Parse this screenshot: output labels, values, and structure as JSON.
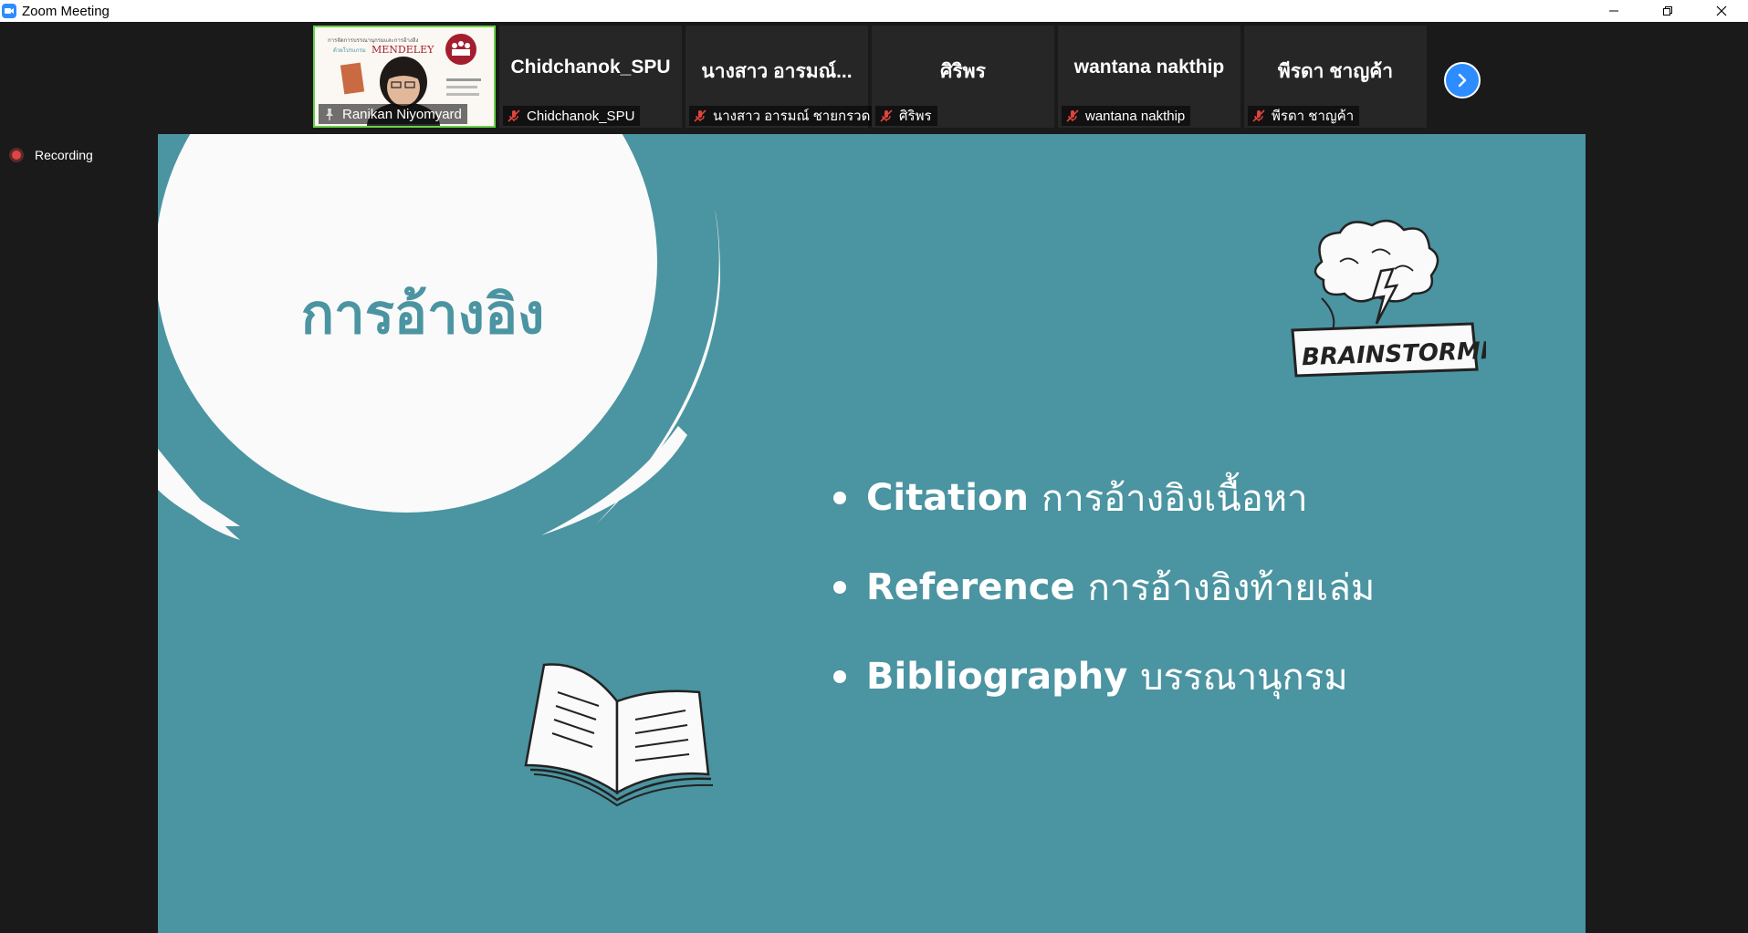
{
  "window": {
    "title": "Zoom Meeting",
    "icon": "zoom-camera-icon"
  },
  "thumbnail": {
    "heading": "การจัดการบรรณานุกรมและการอ้างอิง",
    "sub": "ด้วยโปรแกรม",
    "brand": "MENDELEY"
  },
  "participants": [
    {
      "name": "Ranikan Niyomyard",
      "type": "video",
      "pinned": true
    },
    {
      "display": "Chidchanok_SPU",
      "name": "Chidchanok_SPU",
      "muted": true
    },
    {
      "display": "นางสาว อารมณ์...",
      "name": "นางสาว อารมณ์ ชายกรวด",
      "muted": true
    },
    {
      "display": "ศิริพร",
      "name": "ศิริพร",
      "muted": true
    },
    {
      "display": "wantana nakthip",
      "name": "wantana nakthip",
      "muted": true
    },
    {
      "display": "พีรดา ชาญค้า",
      "name": "พีรดา ชาญค้า",
      "muted": true
    }
  ],
  "recording": {
    "label": "Recording"
  },
  "slide": {
    "title": "การอ้างอิง",
    "badge": "BRAINSTORMING",
    "bullets": [
      {
        "term": "Citation",
        "thai": "การอ้างอิงเนื้อหา"
      },
      {
        "term": "Reference",
        "thai": "การอ้างอิงท้ายเล่ม"
      },
      {
        "term": "Bibliography",
        "thai": "บรรณานุกรม"
      }
    ]
  },
  "colors": {
    "slide_bg": "#4b94a1",
    "accent": "#2d8cff",
    "mute_red": "#e0443e",
    "recording_red": "#e0443e"
  }
}
